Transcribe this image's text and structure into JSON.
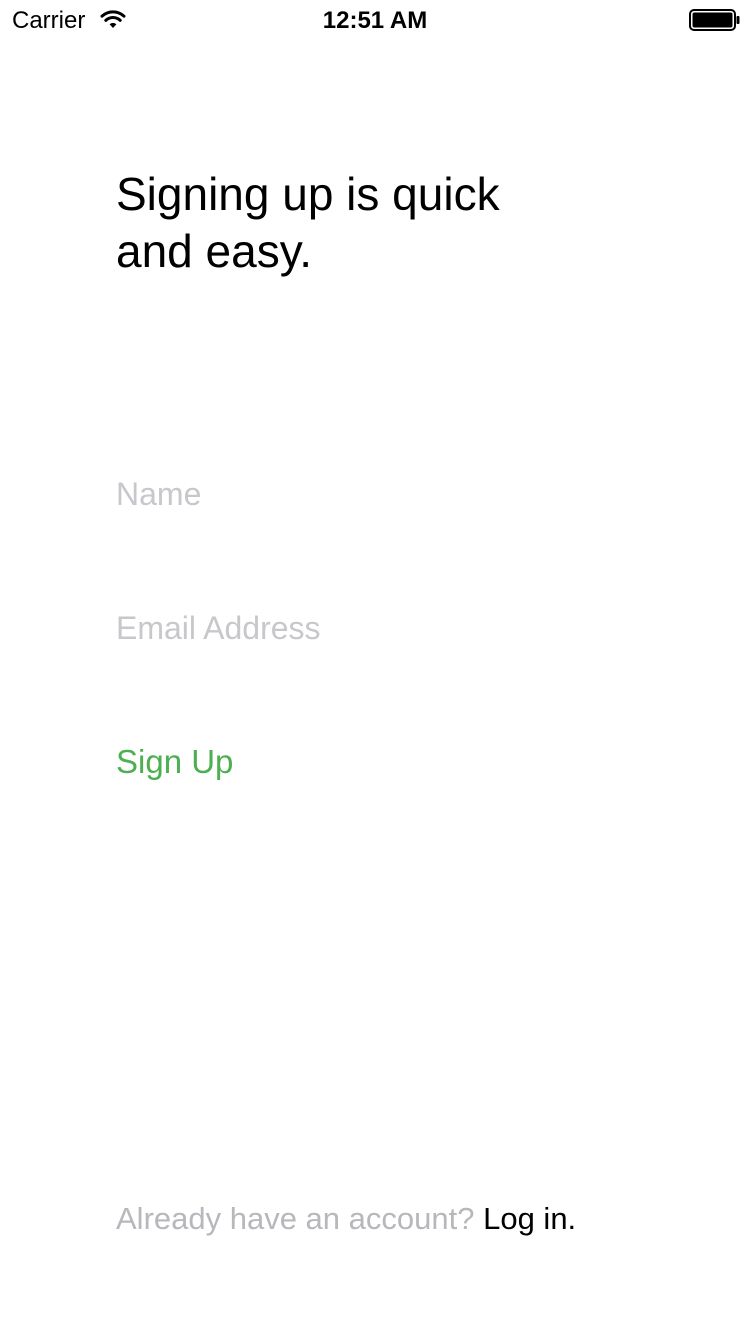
{
  "status_bar": {
    "carrier": "Carrier",
    "time": "12:51 AM",
    "wifi_icon": "wifi-icon",
    "battery_icon": "battery-icon"
  },
  "headline": "Signing up is quick and easy.",
  "form": {
    "name_placeholder": "Name",
    "name_value": "",
    "email_placeholder": "Email Address",
    "email_value": "",
    "signup_label": "Sign Up"
  },
  "footer": {
    "prompt": "Already have an account?",
    "login_label": "Log in."
  },
  "colors": {
    "accent": "#4caf50",
    "placeholder": "#c7c7cc",
    "muted_text": "#b7b7bc",
    "text": "#000000",
    "background": "#ffffff"
  }
}
